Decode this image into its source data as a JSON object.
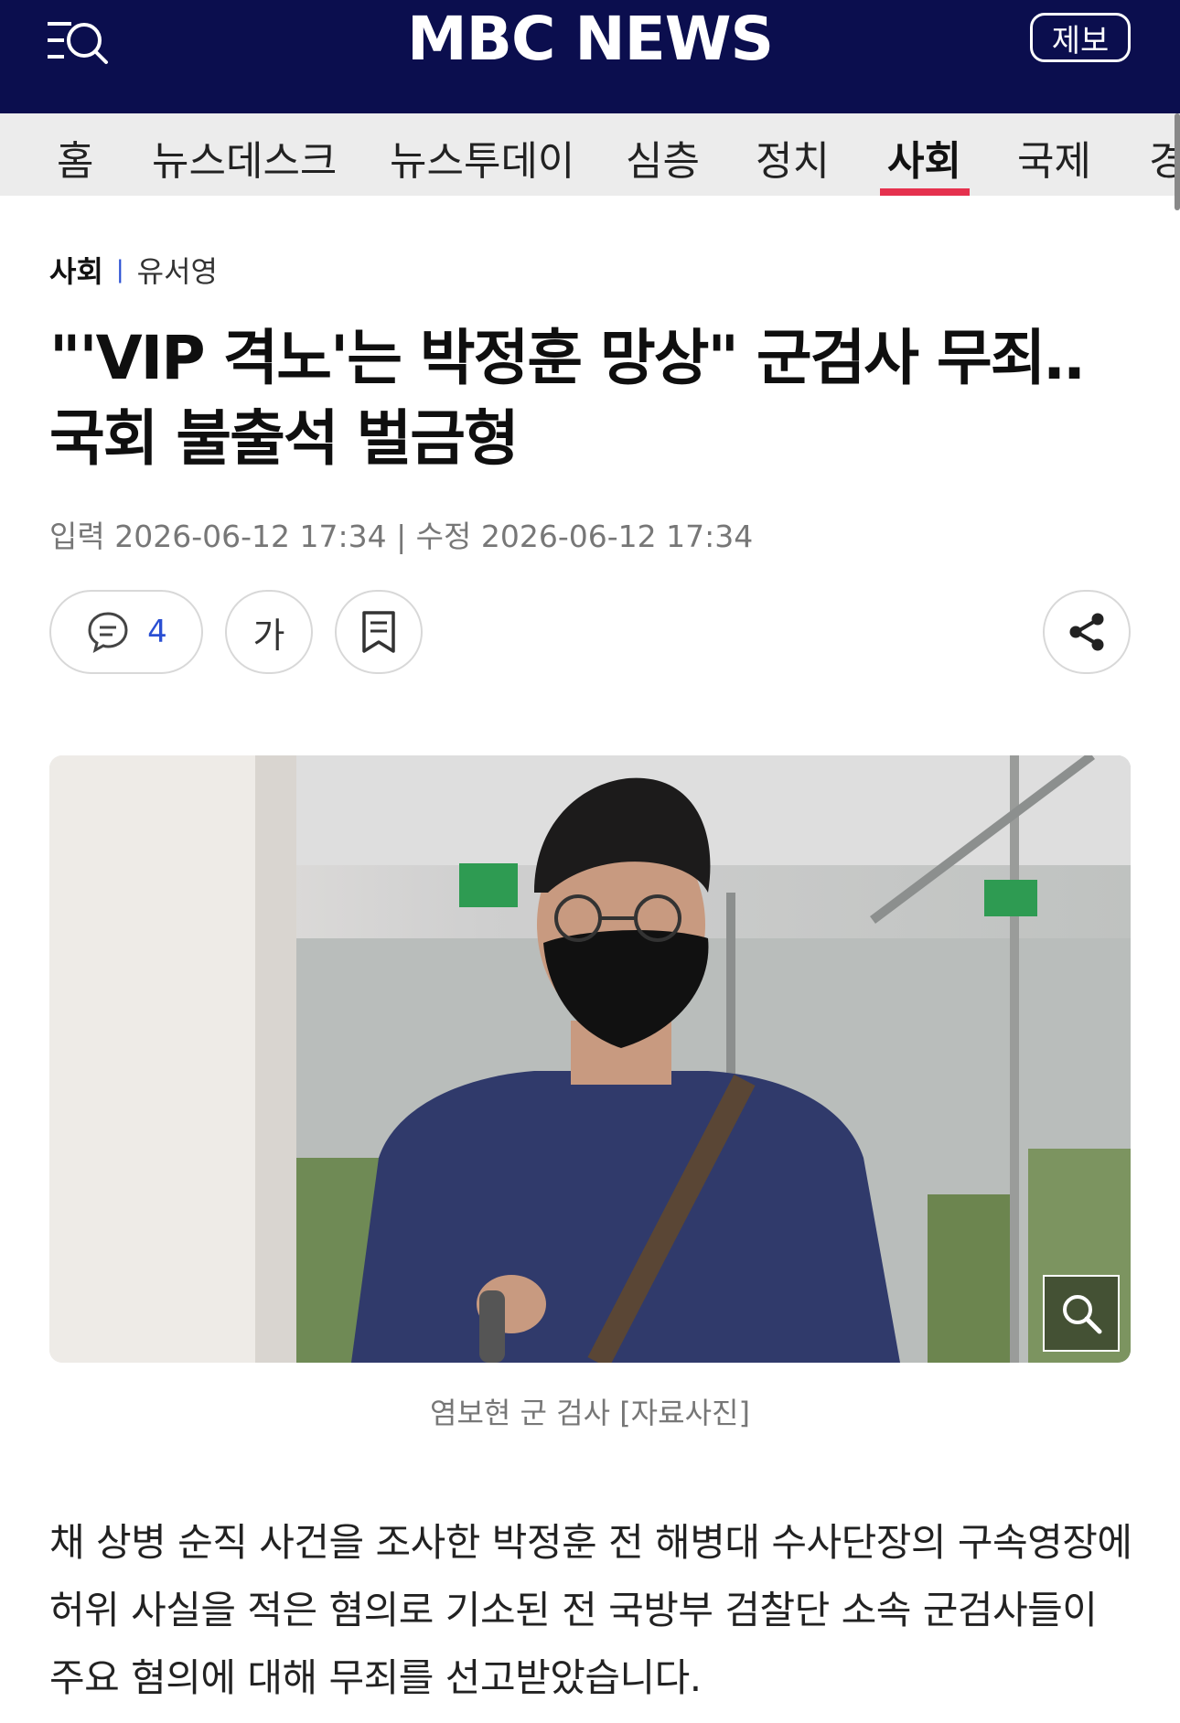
{
  "header": {
    "logo_text": "MBC NEWS",
    "tip_label": "제보",
    "menu_icon": "menu-search-icon",
    "bg_color": "#0b0e4e"
  },
  "nav": {
    "items": [
      "홈",
      "뉴스데스크",
      "뉴스투데이",
      "심층",
      "정치",
      "사회",
      "국제",
      "경"
    ],
    "active_index": 5,
    "active_color": "#e5314e"
  },
  "article": {
    "section": "사회",
    "author": "유서영",
    "headline": "\"'VIP 격노'는 박정훈 망상\" 군검사 무죄‥국회 불출석 벌금형",
    "dates_text": "입력 2026-06-12 17:34 | 수정 2026-06-12 17:34",
    "comment_count": "4",
    "font_button_label": "가",
    "photo_caption": "염보현 군 검사 [자료사진]",
    "body": "채 상병 순직 사건을 조사한 박정훈 전 해병대 수사단장의 구속영장에 허위 사실을 적은 혐의로 기소된 전 국방부 검찰단 소속 군검사들이 주요 혐의에 대해 무죄를 선고받았습니다."
  },
  "icons": {
    "comment": "comment-icon",
    "bookmark": "bookmark-icon",
    "share": "share-icon",
    "zoom": "zoom-icon"
  }
}
